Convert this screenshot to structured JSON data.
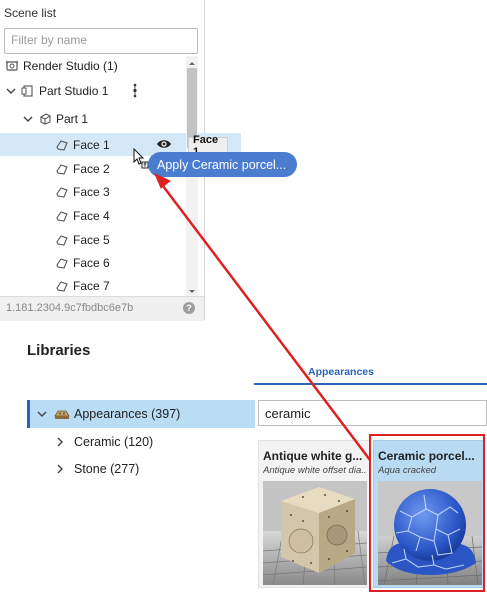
{
  "scene_list": {
    "title": "Scene list",
    "filter_placeholder": "Filter by name",
    "items": [
      {
        "label": "Render Studio (1)"
      },
      {
        "label": "Part Studio 1"
      },
      {
        "label": "Part 1"
      },
      {
        "label": "Face 1"
      },
      {
        "label": "Face 2"
      },
      {
        "label": "Face 3"
      },
      {
        "label": "Face 4"
      },
      {
        "label": "Face 5"
      },
      {
        "label": "Face 6"
      },
      {
        "label": "Face 7"
      }
    ],
    "version": "1.181.2304.9c7fbdbc6e7b",
    "help": "?"
  },
  "tooltip": {
    "label": "Face 1"
  },
  "drag": {
    "label": "Apply Ceramic porcel..."
  },
  "libraries": {
    "title": "Libraries",
    "active_tab": "Appearances",
    "tree": [
      {
        "label": "Appearances (397)"
      },
      {
        "label": "Ceramic (120)"
      },
      {
        "label": "Stone (277)"
      }
    ],
    "search_value": "ceramic",
    "cards": [
      {
        "title": "Antique white g...",
        "subtitle": "Antique white offset dia..."
      },
      {
        "title": "Ceramic porcel...",
        "subtitle": "Aqua cracked"
      }
    ]
  },
  "colors": {
    "accent": "#2a63b8",
    "selection": "#d5e8f8",
    "drag_pill": "#4a7ccf",
    "annotation_red": "#e02020"
  }
}
